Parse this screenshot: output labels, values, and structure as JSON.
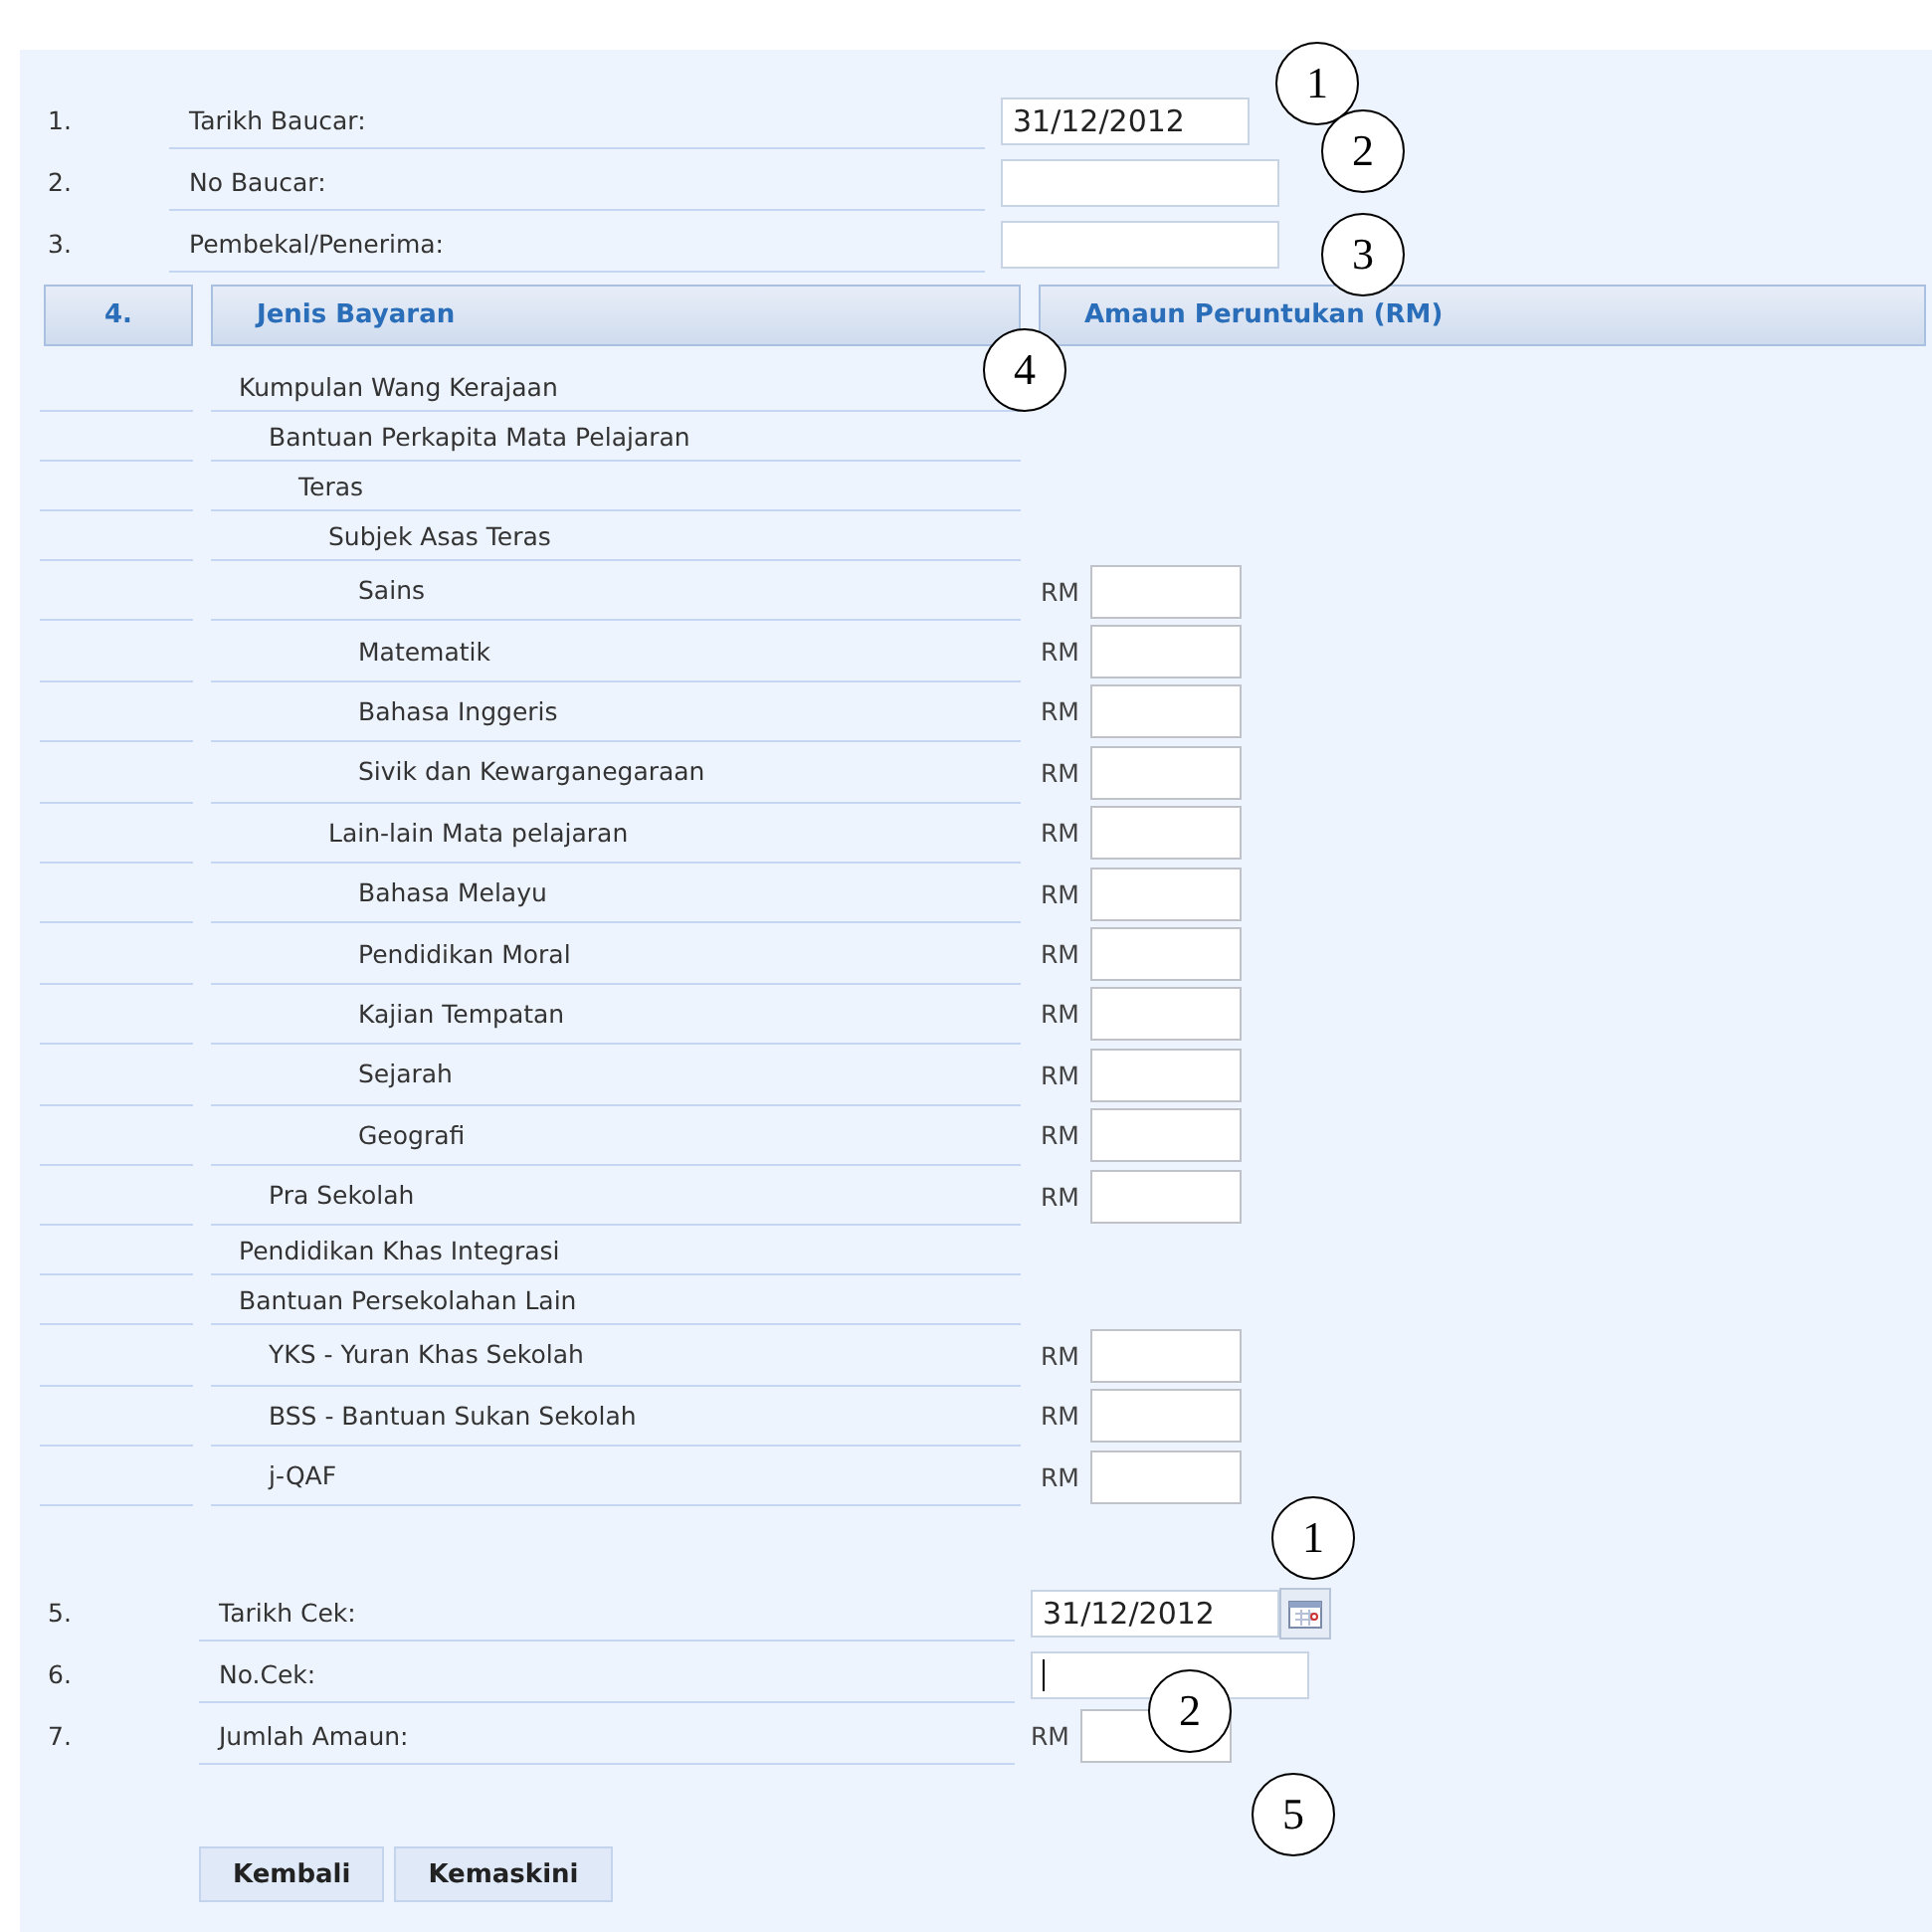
{
  "voucher_fields": [
    {
      "number": "1.",
      "label": "Tarikh Baucar:",
      "kind": "date",
      "value": "31/12/2012"
    },
    {
      "number": "2.",
      "label": "No Baucar:",
      "kind": "text"
    },
    {
      "number": "3.",
      "label": "Pembekal/Penerima:",
      "kind": "text"
    }
  ],
  "table_header": {
    "number": "4.",
    "columns": [
      "Jenis Bayaran",
      "Amaun Peruntukan (RM)"
    ]
  },
  "allocations": [
    {
      "label": "Kumpulan Wang Kerajaan",
      "kind": "heading",
      "children": [
        {
          "label": "Bantuan Perkapita Mata Pelajaran",
          "kind": "heading",
          "children": [
            {
              "label": "Teras",
              "kind": "heading",
              "children": [
                {
                  "label": "Subjek Asas Teras",
                  "kind": "heading",
                  "children": [
                    {
                      "label": "Sains",
                      "kind": "amount",
                      "currency": "RM"
                    },
                    {
                      "label": "Matematik",
                      "kind": "amount",
                      "currency": "RM"
                    },
                    {
                      "label": "Bahasa Inggeris",
                      "kind": "amount",
                      "currency": "RM"
                    },
                    {
                      "label": "Sivik dan Kewarganegaraan",
                      "kind": "amount",
                      "currency": "RM"
                    }
                  ]
                },
                {
                  "label": "Lain-lain Mata pelajaran",
                  "kind": "amount",
                  "currency": "RM",
                  "children": [
                    {
                      "label": "Bahasa Melayu",
                      "kind": "amount",
                      "currency": "RM"
                    },
                    {
                      "label": "Pendidikan Moral",
                      "kind": "amount",
                      "currency": "RM"
                    },
                    {
                      "label": "Kajian Tempatan",
                      "kind": "amount",
                      "currency": "RM"
                    },
                    {
                      "label": "Sejarah",
                      "kind": "amount",
                      "currency": "RM"
                    },
                    {
                      "label": "Geografi",
                      "kind": "amount",
                      "currency": "RM"
                    }
                  ]
                }
              ]
            }
          ]
        },
        {
          "label": "Pra Sekolah",
          "kind": "amount",
          "currency": "RM"
        }
      ]
    },
    {
      "label": "Pendidikan Khas Integrasi",
      "kind": "heading"
    },
    {
      "label": "Bantuan Persekolahan Lain",
      "kind": "heading",
      "children": [
        {
          "label": "YKS - Yuran Khas Sekolah",
          "kind": "amount",
          "currency": "RM"
        },
        {
          "label": "BSS - Bantuan Sukan Sekolah",
          "kind": "amount",
          "currency": "RM"
        },
        {
          "label": "j-QAF",
          "kind": "amount",
          "currency": "RM"
        }
      ]
    }
  ],
  "cheque_fields": [
    {
      "number": "5.",
      "label": "Tarikh Cek:",
      "kind": "date",
      "value": "31/12/2012",
      "has_picker": true
    },
    {
      "number": "6.",
      "label": "No.Cek:",
      "kind": "text",
      "focused": true
    },
    {
      "number": "7.",
      "label": "Jumlah Amaun:",
      "kind": "amount",
      "currency": "RM"
    }
  ],
  "buttons": [
    "Kembali",
    "Kemaskini"
  ],
  "callouts": [
    "1",
    "2",
    "3",
    "4",
    "1",
    "2",
    "5"
  ]
}
